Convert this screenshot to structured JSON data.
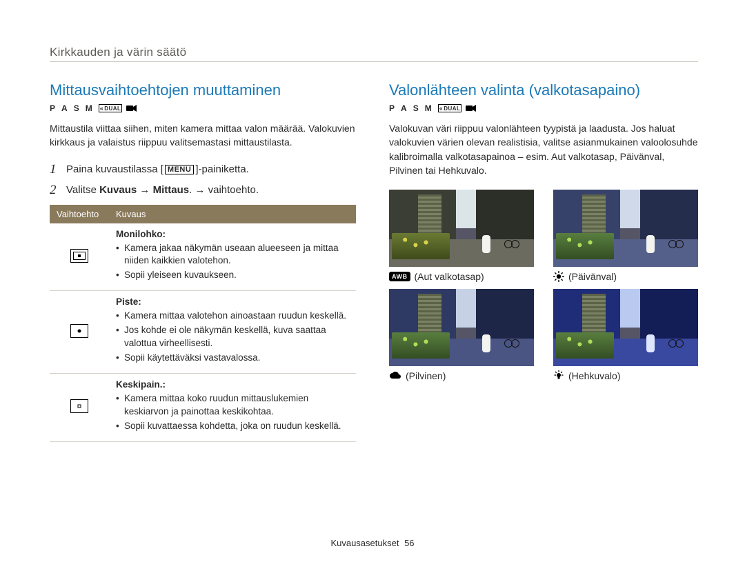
{
  "header": {
    "section_label": "Kirkkauden ja värin säätö"
  },
  "modes": {
    "p": "P",
    "a": "A",
    "s": "S",
    "m": "M",
    "dual": "DUAL"
  },
  "left": {
    "title": "Mittausvaihtoehtojen muuttaminen",
    "intro": "Mittaustila viittaa siihen, miten kamera mittaa valon määrää. Valokuvien kirkkaus ja valaistus riippuu valitsemastasi mittaustilasta.",
    "step1_pre": "Paina kuvaustilassa [",
    "step1_menu": "MENU",
    "step1_post": "]-painiketta.",
    "step2_pre": "Valitse ",
    "step2_b1": "Kuvaus",
    "step2_arrow1": " → ",
    "step2_b2": "Mittaus",
    "step2_post": ". → vaihtoehto.",
    "table": {
      "th_option": "Vaihtoehto",
      "th_desc": "Kuvaus",
      "multi": {
        "title": "Monilohko:",
        "b1": "Kamera jakaa näkymän useaan alueeseen ja mittaa niiden kaikkien valotehon.",
        "b2": "Sopii yleiseen kuvaukseen."
      },
      "spot": {
        "title": "Piste:",
        "b1": "Kamera mittaa valotehon ainoastaan ruudun keskellä.",
        "b2": "Jos kohde ei ole näkymän keskellä, kuva saattaa valottua virheellisesti.",
        "b3": "Sopii käytettäväksi vastavalossa."
      },
      "center": {
        "title": "Keskipain.:",
        "b1": "Kamera mittaa koko ruudun mittauslukemien keskiarvon ja painottaa keskikohtaa.",
        "b2": "Sopii kuvattaessa kohdetta, joka on ruudun keskellä."
      }
    }
  },
  "right": {
    "title": "Valonlähteen valinta (valkotasapaino)",
    "intro": "Valokuvan väri riippuu valonlähteen tyypistä ja laadusta. Jos haluat valokuvien värien olevan realistisia, valitse asianmukainen valoolosuhde kalibroimalla valkotasapainoa – esim. Aut valkotasap, Päivänval, Pilvinen tai Hehkuvalo.",
    "wb": {
      "auto": {
        "badge": "AWB",
        "label": "Aut valkotasap"
      },
      "daylight": {
        "label": "Päivänval"
      },
      "cloudy": {
        "label": "Pilvinen"
      },
      "tungsten": {
        "label": "Hehkuvalo"
      }
    }
  },
  "footer": {
    "section": "Kuvausasetukset",
    "page": "56"
  }
}
